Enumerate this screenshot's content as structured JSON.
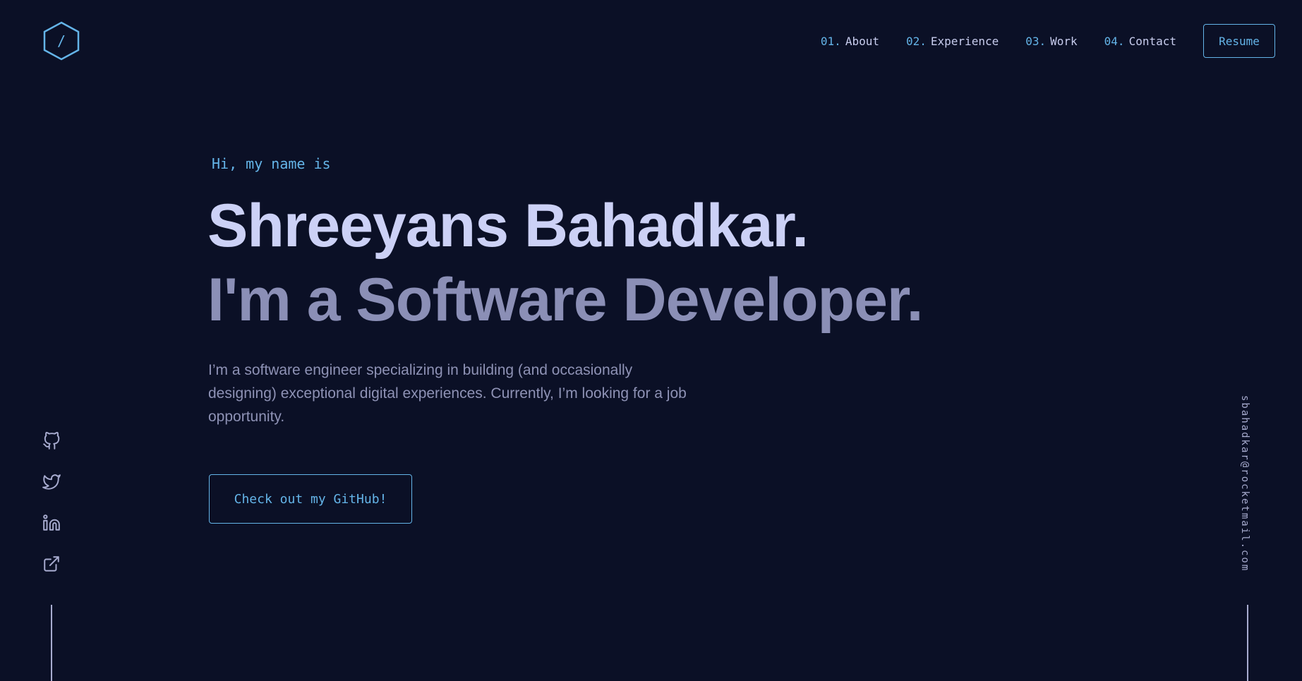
{
  "header": {
    "logo_icon": "hexagon-slash-logo-icon",
    "logo_glyph": "/",
    "nav": [
      {
        "number": "01.",
        "label": "About"
      },
      {
        "number": "02.",
        "label": "Experience"
      },
      {
        "number": "03.",
        "label": "Work"
      },
      {
        "number": "04.",
        "label": "Contact"
      }
    ],
    "resume_label": "Resume"
  },
  "hero": {
    "intro": "Hi, my name is",
    "name": "Shreeyans Bahadkar.",
    "tagline": "I'm a Software Developer.",
    "bio": "I’m a software engineer specializing in building (and occasionally designing) exceptional digital experiences. Currently, I’m looking for a job opportunity.",
    "cta_label": "Check out my GitHub!"
  },
  "social": [
    {
      "icon": "github-icon"
    },
    {
      "icon": "twitter-icon"
    },
    {
      "icon": "linkedin-icon"
    },
    {
      "icon": "external-link-icon"
    }
  ],
  "email": "sbahadkar@rocketmail.com",
  "colors": {
    "background": "#0b1026",
    "accent": "#64b4e8",
    "heading": "#ccd1f6",
    "subheading": "#8b8fb6",
    "body_text": "#8e92b5"
  }
}
